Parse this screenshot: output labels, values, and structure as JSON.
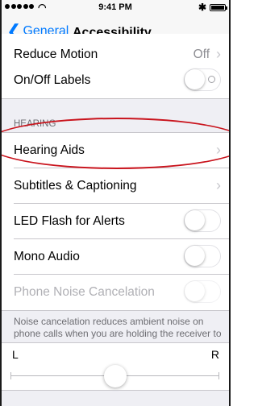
{
  "status_bar": {
    "time": "9:41 PM",
    "wifi_icon": "◠",
    "bluetooth_icon": "✱"
  },
  "nav": {
    "back_label": "General",
    "back_chevron": "❮",
    "title": "Accessibility"
  },
  "cells": {
    "reduce_motion": {
      "label": "Reduce Motion",
      "value": "Off"
    },
    "onoff_labels": {
      "label": "On/Off Labels",
      "state": "off"
    }
  },
  "hearing": {
    "header": "HEARING",
    "hearing_aids": "Hearing Aids",
    "subtitles": "Subtitles & Captioning",
    "led_flash": "LED Flash for Alerts",
    "mono_audio": "Mono Audio",
    "phone_noise": "Phone Noise Cancelation",
    "footer": "Noise cancelation reduces ambient noise on phone calls when you are holding the receiver to your ear."
  },
  "balance": {
    "left": "L",
    "right": "R",
    "value": 0.5
  },
  "chevron": "›",
  "colors": {
    "accent": "#007aff",
    "annotation": "#c9141d"
  }
}
